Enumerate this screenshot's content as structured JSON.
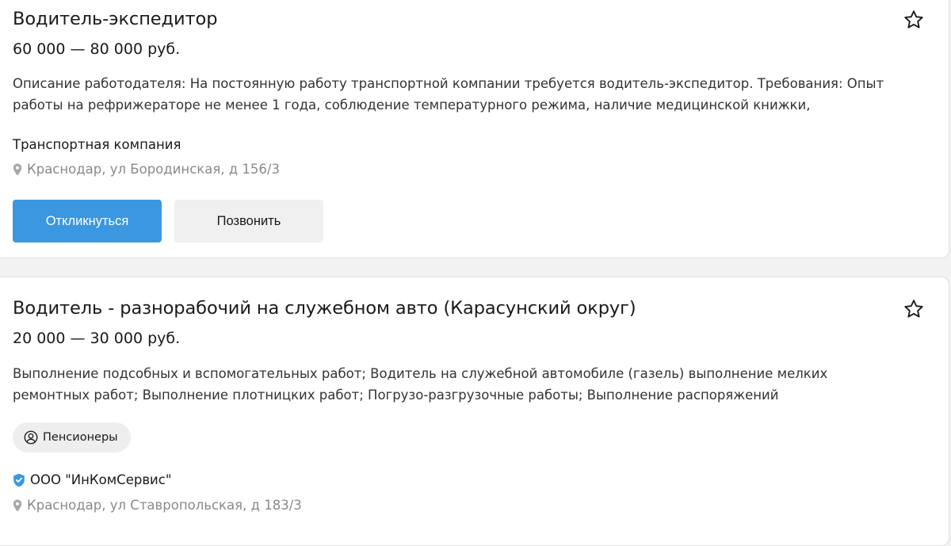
{
  "vacancies": [
    {
      "title": "Водитель-экспедитор",
      "salary": "60 000 — 80 000 руб.",
      "description_line1": "Описание работодателя: На постоянную работу транспортной компании требуется водитель-экспедитор. Требования: Опыт",
      "description_line2": "работы на рефрижераторе не менее 1 года, соблюдение температурного режима, наличие медицинской книжки,",
      "company": "Транспортная компания",
      "address": "Краснодар, ул Бородинская, д 156/3",
      "apply_label": "Откликнуться",
      "call_label": "Позвонить"
    },
    {
      "title": "Водитель - разнорабочий на служебном авто (Карасунский округ)",
      "salary": "20 000 — 30 000 руб.",
      "description_line1": "Выполнение подсобных и вспомогательных работ; Водитель на служебной автомобиле (газель) выполнение мелких",
      "description_line2": "ремонтных работ; Выполнение плотницких работ; Погрузо-разгрузочные работы; Выполнение распоряжений",
      "tag": "Пенсионеры",
      "company": "ООО \"ИнКомСервис\"",
      "address": "Краснодар, ул Ставропольская, д 183/3"
    }
  ],
  "icons": {
    "favorite": "star-outline-icon",
    "location": "map-pin-icon",
    "tag": "user-circle-icon",
    "verified": "verified-shield-icon"
  },
  "colors": {
    "primary_button": "#3a97e0",
    "secondary_button": "#f0f0f0",
    "verified": "#3a97e0",
    "muted_text": "#8a8a8a"
  }
}
